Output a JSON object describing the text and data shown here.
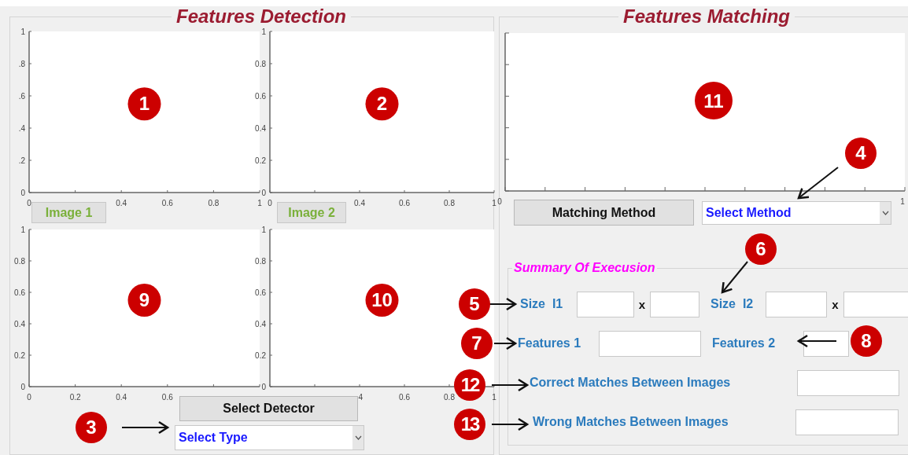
{
  "detection_panel": {
    "title": "Features Detection",
    "plots": [
      {
        "callout": "1",
        "chart_data": {
          "type": "line",
          "xlim": [
            0,
            1
          ],
          "ylim": [
            0,
            1
          ],
          "xticks": [
            0,
            0.4,
            0.6,
            0.8,
            1
          ],
          "yticks": [
            1,
            {
              "value": 0.8,
              "label": ".8"
            },
            {
              "value": 0.6,
              "label": ".6"
            },
            {
              "value": 0.4,
              "label": ".4"
            },
            {
              "value": 0.2,
              "label": ".2"
            },
            0
          ]
        }
      },
      {
        "callout": "2",
        "chart_data": {
          "type": "line",
          "xlim": [
            0,
            1
          ],
          "ylim": [
            0,
            1
          ],
          "xticks": [
            0,
            0.4,
            0.6,
            0.8,
            1
          ],
          "yticks": [
            1,
            0.8,
            0.6,
            0.4,
            0.2,
            0
          ]
        }
      },
      {
        "callout": "9",
        "chart_data": {
          "type": "line",
          "xlim": [
            0,
            1
          ],
          "ylim": [
            0,
            1
          ],
          "xticks": [
            0,
            0.2,
            0.4,
            0.6
          ],
          "yticks": [
            1,
            0.8,
            0.6,
            0.4,
            0.2,
            0
          ]
        }
      },
      {
        "callout": "10",
        "chart_data": {
          "type": "line",
          "xlim": [
            0,
            1
          ],
          "ylim": [
            0,
            1
          ],
          "xticks": [
            {
              "value": 0.4,
              "label": ".4"
            },
            0.6,
            0.8,
            1
          ],
          "yticks": [
            1,
            0.8,
            0.6,
            0.4,
            0.2,
            0
          ]
        }
      }
    ],
    "image_buttons": [
      "Image 1",
      "Image 2"
    ],
    "detector_button": "Select Detector",
    "detector_dropdown": {
      "value": "Select Type"
    }
  },
  "matching_panel": {
    "title": "Features Matching",
    "plot": {
      "callout": "11",
      "axis_labels": [
        "0",
        "1"
      ]
    },
    "method_button": "Matching Method",
    "method_dropdown": {
      "value": "Select Method"
    },
    "summary": {
      "title": "Summary Of Execusion",
      "size_1": {
        "label": "Size  I1",
        "separator": "x"
      },
      "size_2": {
        "label": "Size  I2",
        "separator": "x"
      },
      "features_1": {
        "label": "Features 1"
      },
      "features_2": {
        "label": "Features 2"
      },
      "correct_matches": {
        "label": "Correct Matches Between Images"
      },
      "wrong_matches": {
        "label": "Wrong Matches Between Images"
      }
    }
  },
  "callouts": [
    {
      "label": "3"
    },
    {
      "label": "4"
    },
    {
      "label": "5"
    },
    {
      "label": "6"
    },
    {
      "label": "7"
    },
    {
      "label": "8"
    },
    {
      "label": "12"
    },
    {
      "label": "13"
    }
  ]
}
